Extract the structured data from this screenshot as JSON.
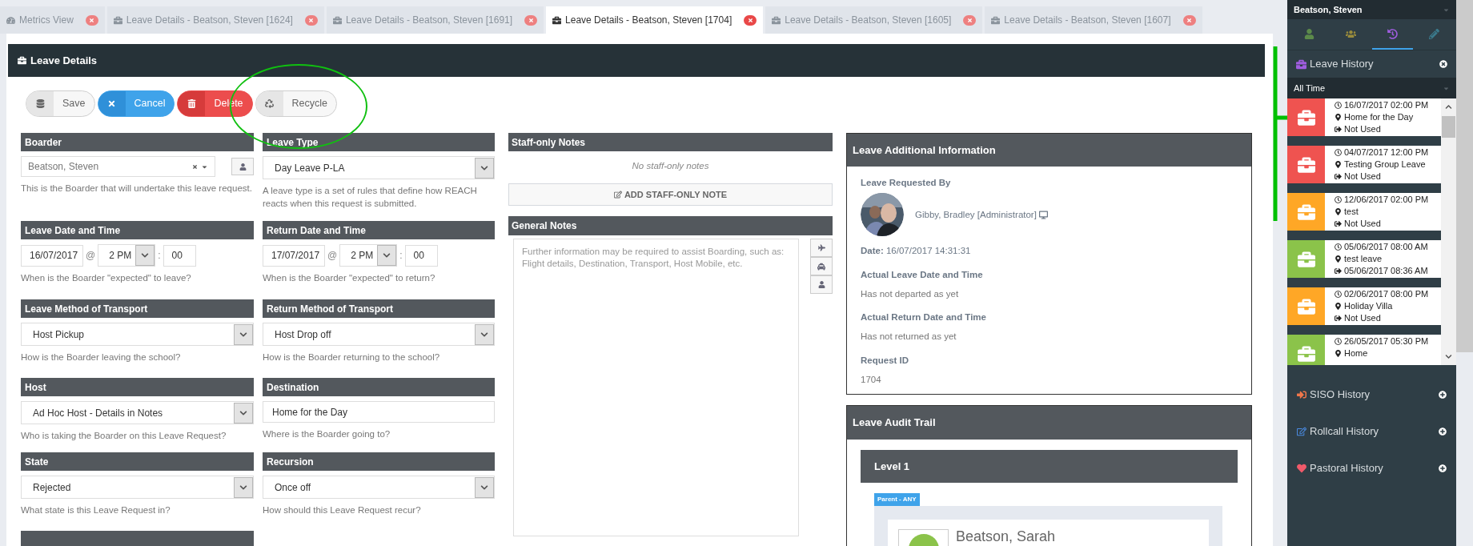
{
  "tabs": [
    {
      "kind": "metrics",
      "label": "Metrics View",
      "selected": false
    },
    {
      "kind": "leave",
      "label": "Leave Details - Beatson, Steven [1624]",
      "selected": false
    },
    {
      "kind": "leave",
      "label": "Leave Details - Beatson, Steven [1691]",
      "selected": false
    },
    {
      "kind": "leave",
      "label": "Leave Details - Beatson, Steven [1704]",
      "selected": true
    },
    {
      "kind": "leave",
      "label": "Leave Details - Beatson, Steven [1605]",
      "selected": false
    },
    {
      "kind": "leave",
      "label": "Leave Details - Beatson, Steven [1607]",
      "selected": false
    }
  ],
  "panel": {
    "title": "Leave Details"
  },
  "actions": [
    {
      "kind": "save",
      "label": "Save"
    },
    {
      "kind": "cancel",
      "label": "Cancel"
    },
    {
      "kind": "delete",
      "label": "Delete"
    },
    {
      "kind": "recycle",
      "label": "Recycle"
    }
  ],
  "form_rows": [
    [
      {
        "kind": "combo",
        "label": "Boarder",
        "value": "Beatson, Steven",
        "help": "This is the Boarder that will undertake this leave request."
      },
      {
        "kind": "select",
        "label": "Leave Type",
        "value": "Day Leave P-LA",
        "help": "A leave type is a set of rules that define how REACH reacts when this request is submitted."
      }
    ],
    [
      {
        "kind": "datetime",
        "label": "Leave Date and Time",
        "date": "16/07/2017",
        "at": "@",
        "hour": "2 PM",
        "colon": ":",
        "minute": "00",
        "help": "When is the Boarder \"expected\" to leave?"
      },
      {
        "kind": "datetime",
        "label": "Return Date and Time",
        "date": "17/07/2017",
        "at": "@",
        "hour": "2 PM",
        "colon": ":",
        "minute": "00",
        "help": "When is the Boarder \"expected\" to return?"
      }
    ],
    [
      {
        "kind": "select",
        "label": "Leave Method of Transport",
        "value": "Host Pickup",
        "help": "How is the Boarder leaving the school?"
      },
      {
        "kind": "select",
        "label": "Return Method of Transport",
        "value": "Host Drop off",
        "help": "How is the Boarder returning to the school?"
      }
    ],
    [
      {
        "kind": "select",
        "label": "Host",
        "value": "Ad Hoc Host - Details in Notes",
        "help": "Who is taking the Boarder on this Leave Request?"
      },
      {
        "kind": "text",
        "label": "Destination",
        "value": "Home for the Day",
        "help": "Where is the Boarder going to?"
      }
    ],
    [
      {
        "kind": "select",
        "label": "State",
        "value": "Rejected",
        "help": "What state is this Leave Request in?"
      },
      {
        "kind": "select",
        "label": "Recursion",
        "value": "Once off",
        "help": "How should this Leave Request recur?"
      }
    ]
  ],
  "staff_notes": {
    "title": "Staff-only Notes",
    "empty": "No staff-only notes",
    "button": "ADD STAFF-ONLY NOTE"
  },
  "general_notes": {
    "title": "General Notes",
    "placeholder": "Further information may be required to assist Boarding, such as: Flight details, Destination, Transport, Host Mobile, etc."
  },
  "additional_info": {
    "title": "Leave Additional Information",
    "requested_by_label": "Leave Requested By",
    "requested_by": "Gibby, Bradley [Administrator]",
    "date_label": "Date:",
    "date": "16/07/2017 14:31:31",
    "items": [
      {
        "label": "Actual Leave Date and Time",
        "value": "Has not departed as yet"
      },
      {
        "label": "Actual Return Date and Time",
        "value": "Has not returned as yet"
      },
      {
        "label": "Request ID",
        "value": "1704"
      }
    ]
  },
  "audit_trail": {
    "title": "Leave Audit Trail",
    "level": "Level 1",
    "badge": "Parent - ANY",
    "person": "Beatson, Sarah"
  },
  "sidebar": {
    "person": "Beatson, Steven",
    "icon_tabs": [
      {
        "kind": "person",
        "selected": false
      },
      {
        "kind": "group",
        "selected": false
      },
      {
        "kind": "history",
        "selected": true
      },
      {
        "kind": "edit",
        "selected": false
      }
    ],
    "leave_history": {
      "title": "Leave History",
      "filter": "All Time",
      "items": [
        {
          "color": "#ef5350",
          "date": "16/07/2017 02:00 PM",
          "place": "Home for the Day",
          "status": "Not Used"
        },
        {
          "color": "#ef5350",
          "date": "04/07/2017 12:00 PM",
          "place": "Testing Group Leave",
          "status": "Not Used"
        },
        {
          "color": "#ffa726",
          "date": "12/06/2017 02:00 PM",
          "place": "test",
          "status": "Not Used"
        },
        {
          "color": "#8bc34a",
          "date": "05/06/2017 08:00 AM",
          "place": "test leave",
          "status": "05/06/2017 08:36 AM"
        },
        {
          "color": "#ffa726",
          "date": "02/06/2017 08:00 PM",
          "place": "Holiday Villa",
          "status": "Not Used"
        },
        {
          "color": "#8bc34a",
          "date": "26/05/2017 05:30 PM",
          "place": "Home"
        }
      ]
    },
    "sections": [
      {
        "kind": "siso",
        "label": "SISO History"
      },
      {
        "kind": "rollcall",
        "label": "Rollcall History"
      },
      {
        "kind": "pastoral",
        "label": "Pastoral History"
      }
    ]
  }
}
